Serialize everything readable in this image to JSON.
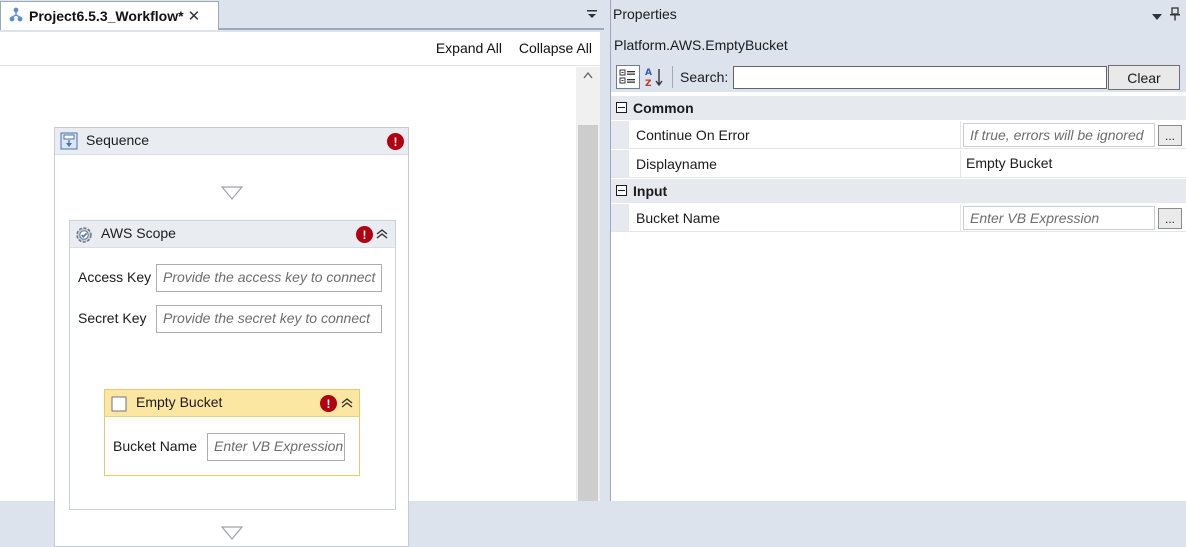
{
  "designer": {
    "tab_title": "Project6.5.3_Workflow*",
    "tab_close": "✕",
    "expand_all": "Expand All",
    "collapse_all": "Collapse All",
    "sequence": {
      "title": "Sequence",
      "error_badge": "!"
    },
    "aws_scope": {
      "title": "AWS Scope",
      "error_badge": "!",
      "access_key_label": "Access Key",
      "access_key_placeholder": "Provide the access key to connect",
      "secret_key_label": "Secret Key",
      "secret_key_placeholder": "Provide the secret key to connect"
    },
    "empty_bucket": {
      "title": "Empty Bucket",
      "error_badge": "!",
      "bucket_name_label": "Bucket Name",
      "bucket_name_placeholder": "Enter VB Expression"
    }
  },
  "properties": {
    "title": "Properties",
    "type_name": "Platform.AWS.EmptyBucket",
    "search_label": "Search:",
    "search_value": "",
    "clear_label": "Clear",
    "ellipsis_label": "...",
    "categories": [
      {
        "name": "Common",
        "props": [
          {
            "name": "Continue On Error",
            "placeholder": "If true, errors will be ignored",
            "value": ""
          },
          {
            "name": "Displayname",
            "value": "Empty Bucket"
          }
        ]
      },
      {
        "name": "Input",
        "props": [
          {
            "name": "Bucket Name",
            "placeholder": "Enter VB Expression",
            "value": ""
          }
        ]
      }
    ]
  },
  "colors": {
    "error_red": "#b00012",
    "selected_activity_header": "#fbe7a1",
    "panel_background": "#dde3ec"
  },
  "icons": {
    "tab": "workflow-project-icon",
    "sequence": "sequence-icon",
    "aws_scope": "gear-check-icon",
    "empty_bucket": "activity-box-icon",
    "categorize": "categorized-view-icon",
    "sort": "alphabetical-sort-icon"
  }
}
